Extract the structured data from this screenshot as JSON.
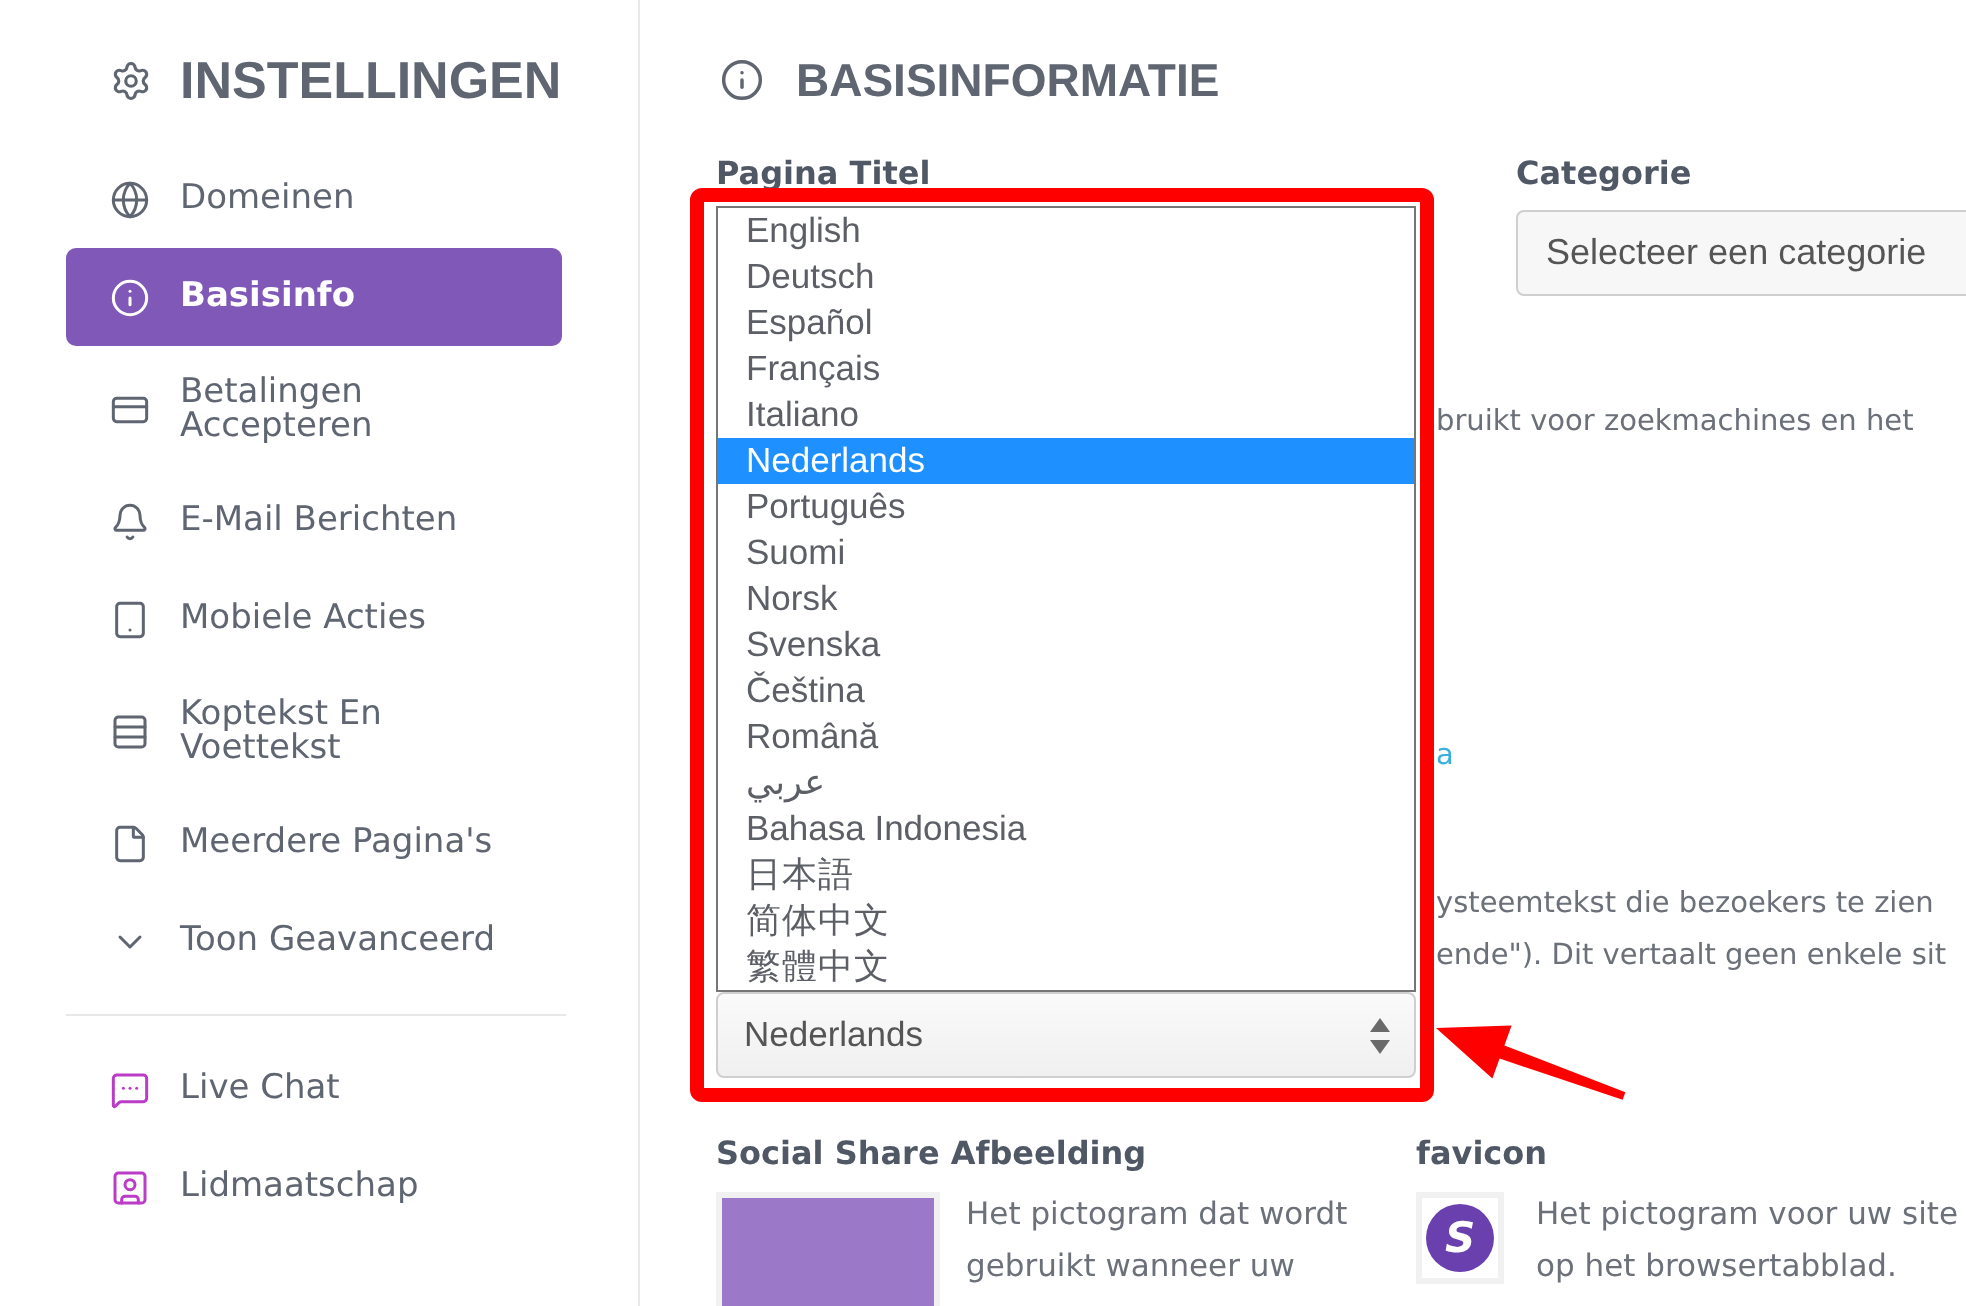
{
  "sidebar": {
    "title": "INSTELLINGEN",
    "items": [
      {
        "label": "Domeinen",
        "selected": false
      },
      {
        "label": "Basisinfo",
        "selected": true
      },
      {
        "label": "Betalingen Accepteren",
        "selected": false
      },
      {
        "label": "E-Mail Berichten",
        "selected": false
      },
      {
        "label": "Mobiele Acties",
        "selected": false
      },
      {
        "label": "Koptekst En Voettekst",
        "selected": false
      },
      {
        "label": "Meerdere Pagina's",
        "selected": false
      },
      {
        "label": "Toon Geavanceerd",
        "selected": false
      }
    ],
    "extra_items": [
      {
        "label": "Live Chat",
        "selected": false
      },
      {
        "label": "Lidmaatschap",
        "selected": false
      }
    ]
  },
  "main": {
    "title": "BASISINFORMATIE",
    "page_title": {
      "label": "Pagina Titel"
    },
    "language_select": {
      "value": "Nederlands",
      "options": [
        {
          "label": "English",
          "selected": false
        },
        {
          "label": "Deutsch",
          "selected": false
        },
        {
          "label": "Español",
          "selected": false
        },
        {
          "label": "Français",
          "selected": false
        },
        {
          "label": "Italiano",
          "selected": false
        },
        {
          "label": "Nederlands",
          "selected": true
        },
        {
          "label": "Português",
          "selected": false
        },
        {
          "label": "Suomi",
          "selected": false
        },
        {
          "label": "Norsk",
          "selected": false
        },
        {
          "label": "Svenska",
          "selected": false
        },
        {
          "label": "Čeština",
          "selected": false
        },
        {
          "label": "Română",
          "selected": false
        },
        {
          "label": "عربي",
          "selected": false
        },
        {
          "label": "Bahasa Indonesia",
          "selected": false
        },
        {
          "label": "日本語",
          "selected": false
        },
        {
          "label": "简体中文",
          "selected": false
        },
        {
          "label": "繁體中文",
          "selected": false
        }
      ]
    },
    "category": {
      "label": "Categorie",
      "value": "Selecteer een categorie"
    },
    "partial_texts": {
      "description_end": "bruikt voor zoekmachines en het",
      "link_end": "a",
      "system_text_end": [
        "ysteemtekst die bezoekers te zien",
        "ende\"). Dit vertaalt geen enkele sit"
      ]
    },
    "social_share": {
      "label": "Social Share Afbeelding",
      "description": [
        "Het pictogram dat wordt",
        "gebruikt wanneer uw"
      ]
    },
    "favicon": {
      "label": "favicon",
      "logo_letter": "S",
      "description": [
        "Het pictogram voor uw site",
        "op het browsertabblad."
      ]
    }
  }
}
